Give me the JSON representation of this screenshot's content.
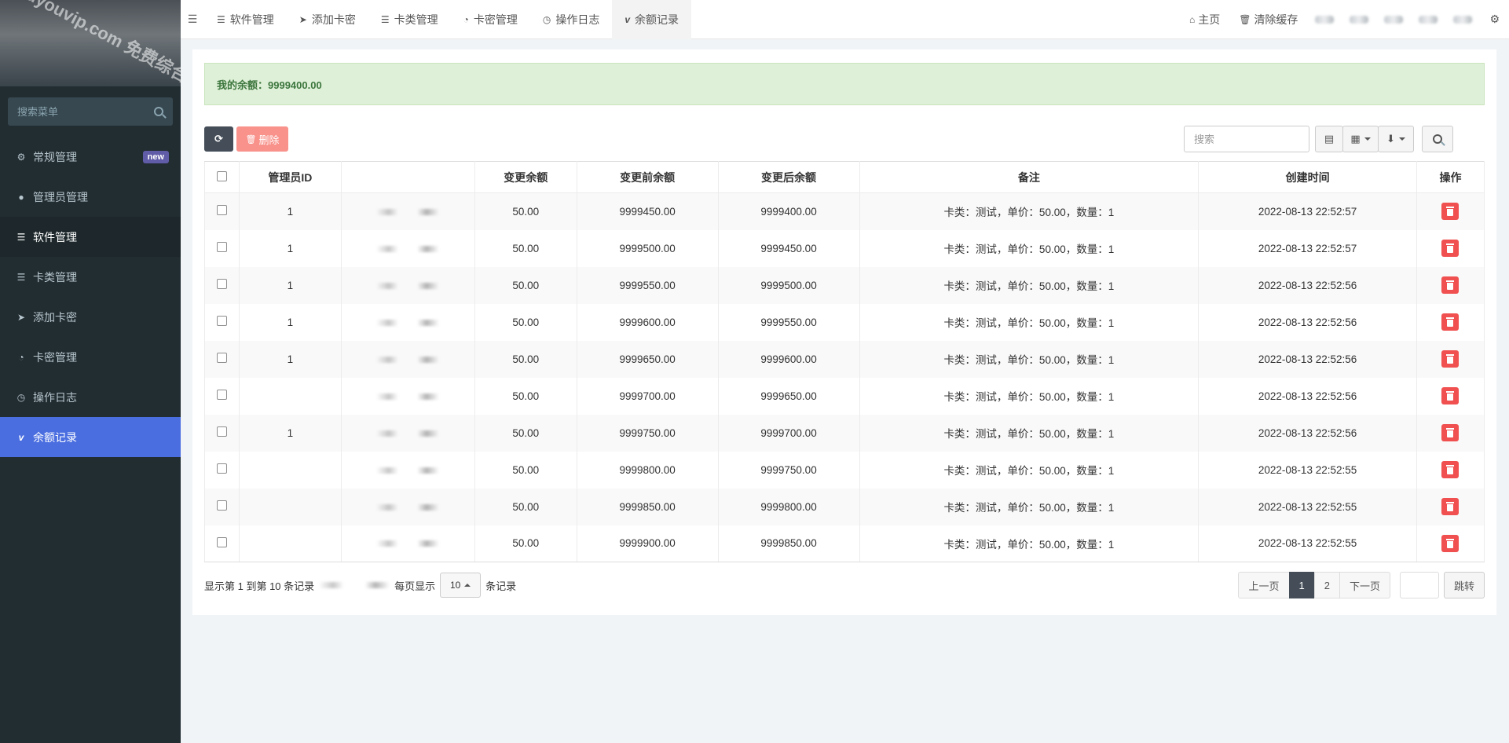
{
  "sidebar": {
    "watermark": "buyouvip.com 免费综合资源网",
    "search_placeholder": "搜索菜单",
    "items": [
      {
        "label": "常规管理",
        "icon": "cogs-icon",
        "badge": "new"
      },
      {
        "label": "管理员管理",
        "icon": "user-icon"
      },
      {
        "label": "软件管理",
        "icon": "list-icon"
      },
      {
        "label": "卡类管理",
        "icon": "list-alt-icon"
      },
      {
        "label": "添加卡密",
        "icon": "paper-plane-icon"
      },
      {
        "label": "卡密管理",
        "icon": "rss-icon"
      },
      {
        "label": "操作日志",
        "icon": "clock-icon"
      },
      {
        "label": "余额记录",
        "icon": "vimeo-icon"
      }
    ]
  },
  "topbar": {
    "tabs": [
      {
        "label": "软件管理",
        "icon": "list-icon"
      },
      {
        "label": "添加卡密",
        "icon": "paper-plane-icon"
      },
      {
        "label": "卡类管理",
        "icon": "list-alt-icon"
      },
      {
        "label": "卡密管理",
        "icon": "rss-icon"
      },
      {
        "label": "操作日志",
        "icon": "clock-icon"
      },
      {
        "label": "余额记录",
        "icon": "vimeo-icon"
      }
    ],
    "home_label": "主页",
    "clear_cache_label": "清除缓存"
  },
  "alert": {
    "text": "我的余额：9999400.00"
  },
  "toolbar": {
    "delete_label": "删除",
    "search_placeholder": "搜索"
  },
  "table": {
    "columns": [
      "管理员ID",
      "",
      "变更余额",
      "变更前余额",
      "变更后余额",
      "备注",
      "创建时间",
      "操作"
    ],
    "rows": [
      {
        "admin_id": "1",
        "change": "50.00",
        "before": "9999450.00",
        "after": "9999400.00",
        "note": "卡类：测试，单价：50.00，数量：1",
        "time": "2022-08-13 22:52:57"
      },
      {
        "admin_id": "1",
        "change": "50.00",
        "before": "9999500.00",
        "after": "9999450.00",
        "note": "卡类：测试，单价：50.00，数量：1",
        "time": "2022-08-13 22:52:57"
      },
      {
        "admin_id": "1",
        "change": "50.00",
        "before": "9999550.00",
        "after": "9999500.00",
        "note": "卡类：测试，单价：50.00，数量：1",
        "time": "2022-08-13 22:52:56"
      },
      {
        "admin_id": "1",
        "change": "50.00",
        "before": "9999600.00",
        "after": "9999550.00",
        "note": "卡类：测试，单价：50.00，数量：1",
        "time": "2022-08-13 22:52:56"
      },
      {
        "admin_id": "1",
        "change": "50.00",
        "before": "9999650.00",
        "after": "9999600.00",
        "note": "卡类：测试，单价：50.00，数量：1",
        "time": "2022-08-13 22:52:56"
      },
      {
        "admin_id": "",
        "change": "50.00",
        "before": "9999700.00",
        "after": "9999650.00",
        "note": "卡类：测试，单价：50.00，数量：1",
        "time": "2022-08-13 22:52:56"
      },
      {
        "admin_id": "1",
        "change": "50.00",
        "before": "9999750.00",
        "after": "9999700.00",
        "note": "卡类：测试，单价：50.00，数量：1",
        "time": "2022-08-13 22:52:56"
      },
      {
        "admin_id": "",
        "change": "50.00",
        "before": "9999800.00",
        "after": "9999750.00",
        "note": "卡类：测试，单价：50.00，数量：1",
        "time": "2022-08-13 22:52:55"
      },
      {
        "admin_id": "",
        "change": "50.00",
        "before": "9999850.00",
        "after": "9999800.00",
        "note": "卡类：测试，单价：50.00，数量：1",
        "time": "2022-08-13 22:52:55"
      },
      {
        "admin_id": "",
        "change": "50.00",
        "before": "9999900.00",
        "after": "9999850.00",
        "note": "卡类：测试，单价：50.00，数量：1",
        "time": "2022-08-13 22:52:55"
      }
    ]
  },
  "footer": {
    "showing_text": "显示第 1 到第 10 条记录",
    "per_page_prefix": "每页显示",
    "per_page_value": "10",
    "per_page_suffix": "条记录",
    "prev_label": "上一页",
    "pages": [
      "1",
      "2"
    ],
    "next_label": "下一页",
    "jump_label": "跳转"
  },
  "colors": {
    "sidebar_bg": "#222d32",
    "active_blue": "#4a6ee0",
    "delete_red": "#f05050",
    "alert_green": "#dff0d8"
  }
}
